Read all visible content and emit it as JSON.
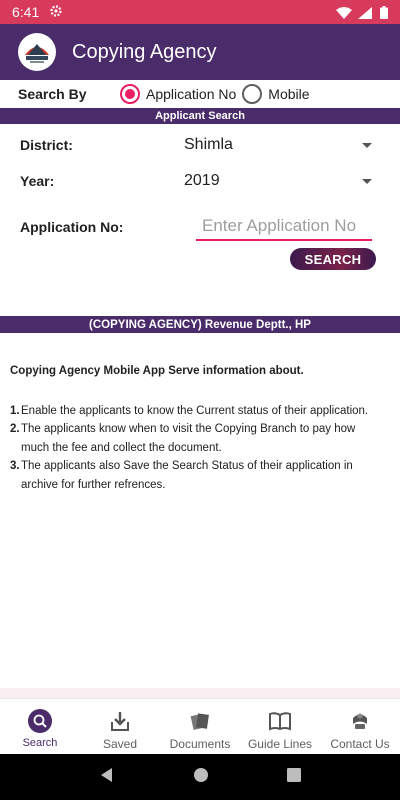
{
  "status_bar": {
    "time": "6:41"
  },
  "app_bar": {
    "title": "Copying Agency"
  },
  "search_by": {
    "label": "Search By",
    "options": [
      {
        "label": "Application No",
        "selected": true
      },
      {
        "label": "Mobile",
        "selected": false
      }
    ]
  },
  "section_header": "Applicant Search",
  "form": {
    "district_label": "District:",
    "district_value": "Shimla",
    "year_label": "Year:",
    "year_value": "2019",
    "application_label": "Application No:",
    "application_placeholder": "Enter Application No",
    "search_button": "SEARCH"
  },
  "footer_band": "(COPYING AGENCY) Revenue Deptt., HP",
  "info": {
    "intro": "Copying Agency Mobile App Serve information about.",
    "points": [
      {
        "num": "1.",
        "text": "Enable the applicants to know the Current status of their application."
      },
      {
        "num": "2.",
        "text": "The applicants know when to visit the Copying Branch to pay how much the fee and collect the document."
      },
      {
        "num": "3.",
        "text": "The applicants also Save the Search Status of their application in archive for further refrences."
      }
    ]
  },
  "bottom_nav": [
    {
      "label": "Search",
      "icon": "search-icon",
      "active": true
    },
    {
      "label": "Saved",
      "icon": "download-icon",
      "active": false
    },
    {
      "label": "Documents",
      "icon": "documents-icon",
      "active": false
    },
    {
      "label": "Guide Lines",
      "icon": "book-icon",
      "active": false
    },
    {
      "label": "Contact Us",
      "icon": "contact-icon",
      "active": false
    }
  ],
  "colors": {
    "primary": "#4a2c6b",
    "accent": "#e91e63",
    "status_bar": "#d73a5a"
  }
}
